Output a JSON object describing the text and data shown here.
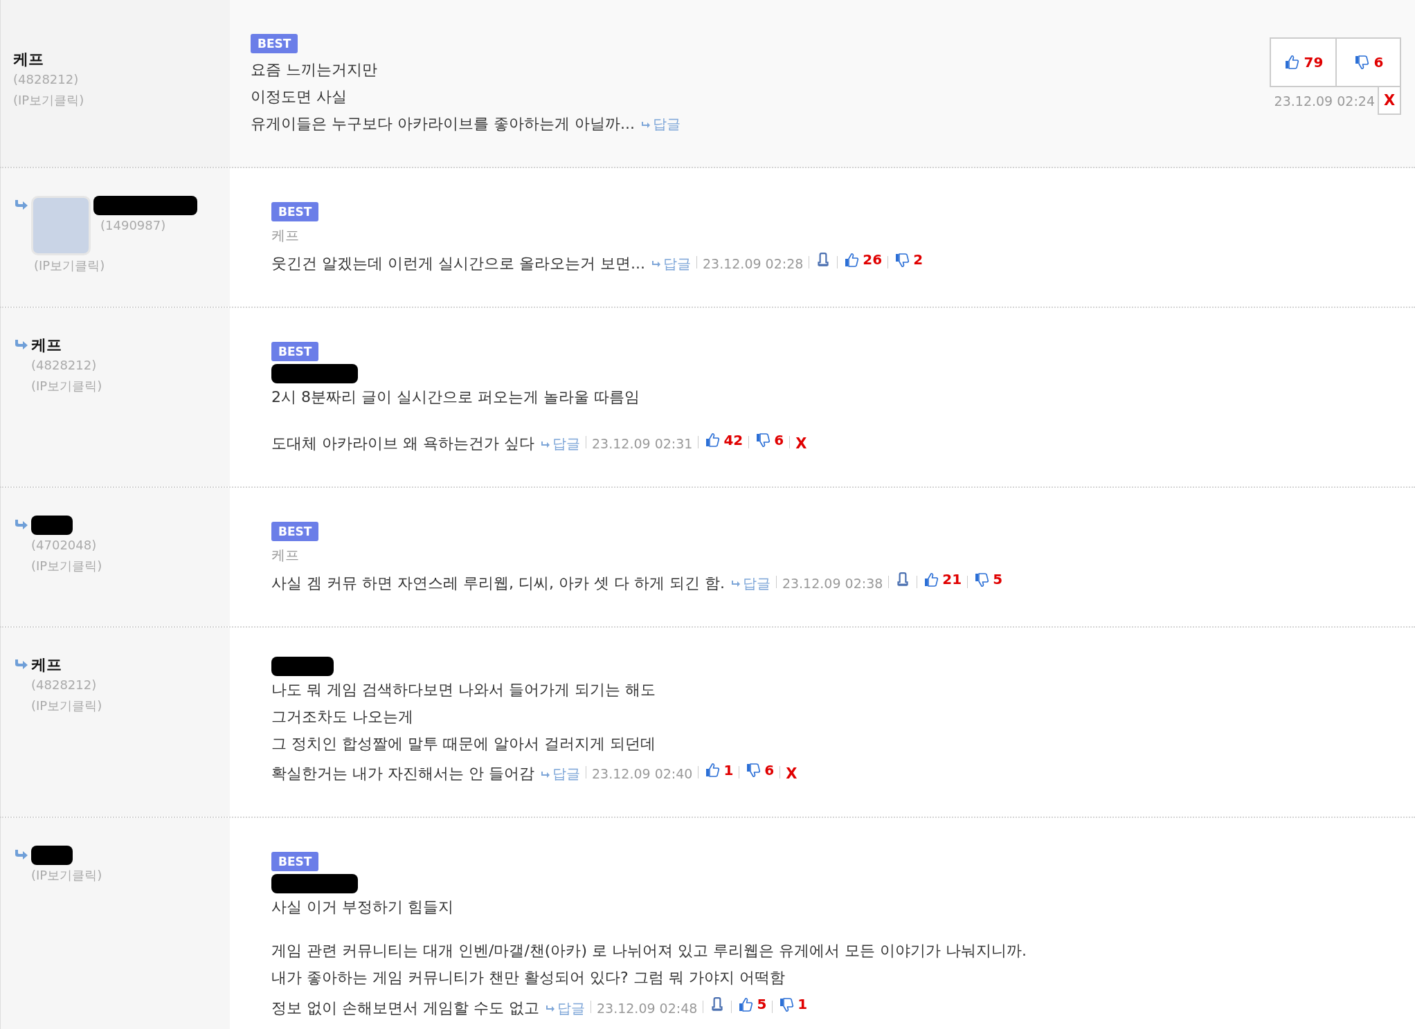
{
  "comments": [
    {
      "kind": "top",
      "badge": "BEST",
      "author": "케프",
      "user_id": "(4828212)",
      "ip": "(IP보기클릭)",
      "paragraphs": [
        [
          "요즘 느끼는거지만",
          "이정도면 사실",
          "유게이들은 누구보다 아카라이브를 좋아하는게 아닐까..."
        ]
      ],
      "reply": "답글",
      "date": "23.12.09 02:24",
      "up": "79",
      "down": "6",
      "delete": "X",
      "reportable": false
    },
    {
      "kind": "reply",
      "badge": "BEST",
      "avatar": true,
      "author_redacted": true,
      "user_id": "(1490987)",
      "ip": "(IP보기클릭)",
      "mention": "케프",
      "paragraphs": [
        [
          "웃긴건 알겠는데 이런게 실시간으로 올라오는거 보면..."
        ]
      ],
      "reply": "답글",
      "date": "23.12.09 02:28",
      "up": "26",
      "down": "2",
      "reportable": true
    },
    {
      "kind": "reply",
      "badge": "BEST",
      "author": "케프",
      "user_id": "(4828212)",
      "ip": "(IP보기클릭)",
      "mention_redacted": true,
      "paragraphs": [
        [
          "2시 8분짜리 글이 실시간으로 퍼오는게 놀라울 따름임"
        ],
        [
          "도대체 아카라이브 왜 욕하는건가 싶다"
        ]
      ],
      "reply": "답글",
      "date": "23.12.09 02:31",
      "up": "42",
      "down": "6",
      "delete": "X",
      "reportable": false
    },
    {
      "kind": "reply",
      "badge": "BEST",
      "author_redacted": true,
      "user_id": "(4702048)",
      "ip": "(IP보기클릭)",
      "mention": "케프",
      "paragraphs": [
        [
          "사실 겜 커뮤 하면 자연스레 루리웹, 디씨, 아카 셋 다 하게 되긴 함."
        ]
      ],
      "reply": "답글",
      "date": "23.12.09 02:38",
      "up": "21",
      "down": "5",
      "reportable": true
    },
    {
      "kind": "reply",
      "author": "케프",
      "user_id": "(4828212)",
      "ip": "(IP보기클릭)",
      "mention_redacted": true,
      "paragraphs": [
        [
          "나도 뭐 게임 검색하다보면 나와서 들어가게 되기는 해도",
          "그거조차도 나오는게",
          "그 정치인 합성짤에 말투 때문에 알아서 걸러지게 되던데",
          "확실한거는 내가 자진해서는 안 들어감"
        ]
      ],
      "reply": "답글",
      "date": "23.12.09 02:40",
      "up": "1",
      "down": "6",
      "delete": "X",
      "reportable": false
    },
    {
      "kind": "reply",
      "badge": "BEST",
      "author_redacted": true,
      "ip": "(IP보기클릭)",
      "mention_redacted": true,
      "paragraphs": [
        [
          "사실 이거 부정하기 힘들지"
        ],
        [
          "게임 관련 커뮤니티는 대개 인벤/마갤/챈(아카) 로 나뉘어져 있고 루리웹은 유게에서 모든 이야기가 나눠지니까.",
          "내가 좋아하는 게임 커뮤니티가 챈만 활성되어 있다? 그럼 뭐 가야지 어떡함",
          "정보 없이 손해보면서 게임할 수도 없고"
        ]
      ],
      "reply": "답글",
      "date": "23.12.09 02:48",
      "up": "5",
      "down": "1",
      "reportable": true
    }
  ]
}
